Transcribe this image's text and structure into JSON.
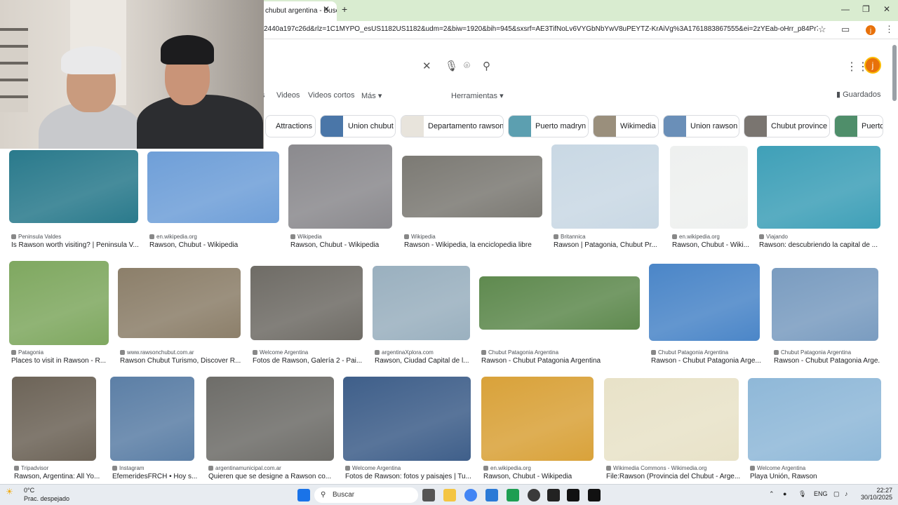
{
  "browser": {
    "tab_title": "chubut argentina - Busc",
    "url": "2440a197c26d&rlz=1C1MYPO_esUS1182US1182&udm=2&biw=1920&bih=945&sxsrf=AE3TifNoLv6VYGbNbYwV8uPEYTZ-KrAiVg%3A1761883867555&ei=2zYEab-oHrr_p84Pr7f5yA4&oq=R",
    "profile_letter": "j"
  },
  "search": {
    "query": "",
    "avatar_letter": "j"
  },
  "tabs": [
    {
      "label": "s"
    },
    {
      "label": "Videos"
    },
    {
      "label": "Videos cortos"
    },
    {
      "label": "Más"
    },
    {
      "label": "Herramientas"
    }
  ],
  "saved_label": "Guardados",
  "chips": [
    {
      "label": "Attractions"
    },
    {
      "label": "Union chubut"
    },
    {
      "label": "Departamento rawson"
    },
    {
      "label": "Puerto madryn"
    },
    {
      "label": "Wikimedia"
    },
    {
      "label": "Union rawson"
    },
    {
      "label": "Chubut province"
    },
    {
      "label": "Puerto"
    }
  ],
  "results": [
    {
      "source": "Peninsula Valdes",
      "title": "Is Rawson worth visiting? | Peninsula V...",
      "color": "#2a7a8c"
    },
    {
      "source": "en.wikipedia.org",
      "title": "Rawson, Chubut - Wikipedia",
      "color": "#6f9fd8"
    },
    {
      "source": "Wikipedia",
      "title": "Rawson, Chubut - Wikipedia",
      "color": "#8b8a8e"
    },
    {
      "source": "Wikipedia",
      "title": "Rawson - Wikipedia, la enciclopedia libre",
      "color": "#7c7a74"
    },
    {
      "source": "Britannica",
      "title": "Rawson | Patagonia, Chubut Pr...",
      "color": "#c9d8e4"
    },
    {
      "source": "en.wikipedia.org",
      "title": "Rawson, Chubut - Wiki...",
      "color": "#eef0ef"
    },
    {
      "source": "Viajando",
      "title": "Rawson: descubriendo la capital de ...",
      "color": "#3fa0b8"
    },
    {
      "source": "Patagonia",
      "title": "Places to visit in Rawson - R...",
      "color": "#7fa860"
    },
    {
      "source": "www.rawsonchubut.com.ar",
      "title": "Rawson Chubut Turismo, Discover R...",
      "color": "#8c7f6a"
    },
    {
      "source": "Welcome Argentina",
      "title": "Fotos de Rawson, Galería 2 - Pai...",
      "color": "#6f6c66"
    },
    {
      "source": "argentinaXplora.com",
      "title": "Rawson, Ciudad Capital de l...",
      "color": "#9ab0bf"
    },
    {
      "source": "Chubut Patagonia Argentina",
      "title": "Rawson - Chubut Patagonia Argentina",
      "color": "#5f8a4f"
    },
    {
      "source": "Chubut Patagonia Argentina",
      "title": "Rawson - Chubut Patagonia Arge...",
      "color": "#4b86c8"
    },
    {
      "source": "Chubut Patagonia Argentina",
      "title": "Rawson - Chubut Patagonia Arge...",
      "color": "#7a9cc0"
    },
    {
      "source": "Tripadvisor",
      "title": "Rawson, Argentina: All Yo...",
      "color": "#6d6458"
    },
    {
      "source": "Instagram",
      "title": "EfemeridesFRCH • Hoy s...",
      "color": "#5c7fa6"
    },
    {
      "source": "argentinamunicipal.com.ar",
      "title": "Quieren que se designe a Rawson co...",
      "color": "#6e6d69"
    },
    {
      "source": "Welcome Argentina",
      "title": "Fotos de Rawson: fotos y paisajes | Tu...",
      "color": "#3f5f8a"
    },
    {
      "source": "en.wikipedia.org",
      "title": "Rawson, Chubut - Wikipedia",
      "color": "#d9a23a"
    },
    {
      "source": "Wikimedia Commons - Wikimedia.org",
      "title": "File:Rawson (Provincia del Chubut - Arge...",
      "color": "#e8e2c8"
    },
    {
      "source": "Welcome Argentina",
      "title": "Playa Unión, Rawson",
      "color": "#8fb8d8"
    }
  ],
  "taskbar": {
    "weather_temp": "0°C",
    "weather_desc": "Prac. despejado",
    "search_label": "Buscar",
    "lang": "ENG",
    "time": "22:27",
    "date": "30/10/2025"
  }
}
